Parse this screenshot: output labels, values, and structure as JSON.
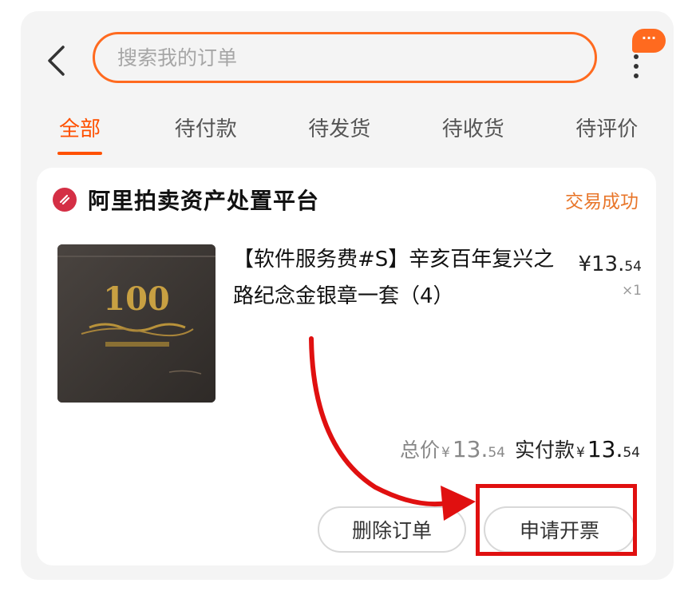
{
  "header": {
    "search_placeholder": "搜索我的订单",
    "message_badge": "···"
  },
  "tabs": [
    {
      "label": "全部",
      "active": true
    },
    {
      "label": "待付款",
      "active": false
    },
    {
      "label": "待发货",
      "active": false
    },
    {
      "label": "待收货",
      "active": false
    },
    {
      "label": "待评价",
      "active": false
    }
  ],
  "order": {
    "shop_name": "阿里拍卖资产处置平台",
    "status": "交易成功",
    "product_title": "【软件服务费#S】辛亥百年复兴之路纪念金银章一套（4）",
    "unit_price_int": "¥13.",
    "unit_price_dec": "54",
    "quantity": "×1",
    "total_label": "总价",
    "total_yen": "¥",
    "total_int": "13.",
    "total_dec": "54",
    "paid_label": "实付款",
    "paid_yen": "¥",
    "paid_int": "13.",
    "paid_dec": "54",
    "product_image_text": "100"
  },
  "actions": {
    "delete_label": "删除订单",
    "invoice_label": "申请开票"
  },
  "colors": {
    "accent": "#ff5000",
    "search_border": "#ff6a1f",
    "status": "#e8762a",
    "annotation": "#e01010"
  }
}
